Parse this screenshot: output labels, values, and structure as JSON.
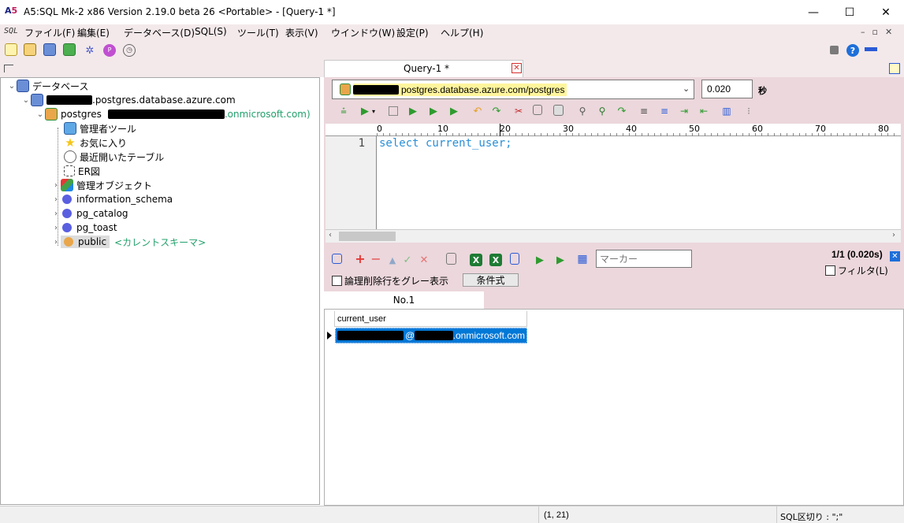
{
  "window": {
    "title": "A5:SQL Mk-2 x86 Version 2.19.0 beta 26 <Portable> - [Query-1 *]",
    "minimize": "—",
    "maximize": "☐",
    "close": "✕"
  },
  "menu": {
    "sql_logo": "SQL",
    "items": [
      "ファイル(F)",
      "編集(E)",
      "データベース(D)",
      "SQL(S)",
      "ツール(T)",
      "表示(V)",
      "ウインドウ(W)",
      "設定(P)",
      "ヘルプ(H)"
    ]
  },
  "tree": {
    "root": "データベース",
    "server_suffix": ".postgres.database.azure.com",
    "db_name": "postgres",
    "db_user_suffix": ".onmicrosoft.com)",
    "items": [
      "管理者ツール",
      "お気に入り",
      "最近開いたテーブル",
      "ER図",
      "管理オブジェクト",
      "information_schema",
      "pg_catalog",
      "pg_toast",
      "public"
    ],
    "current_schema": "<カレントスキーマ>"
  },
  "query_tab": {
    "label": "Query-1 *"
  },
  "connection": {
    "suffix": "postgres.database.azure.com/postgres"
  },
  "exec_time": {
    "value": "0.020",
    "unit": "秒"
  },
  "ruler": {
    "ticks": [
      "0",
      "10",
      "20",
      "30",
      "40",
      "50",
      "60",
      "70",
      "80"
    ]
  },
  "editor": {
    "line_number": "1",
    "code": "select current_user;"
  },
  "result_toolbar": {
    "marker_placeholder": "マーカー",
    "row_info": "1/1 (0.020s)",
    "filter_label": "フィルタ(L)",
    "gray_deleted_label": "論理削除行をグレー表示",
    "condition_button": "条件式"
  },
  "result_tab": {
    "label": "No.1"
  },
  "grid": {
    "columns": [
      "current_user"
    ],
    "rows": [
      [
        "@.onmicrosoft.com"
      ]
    ],
    "cell_visible_suffix": ".onmicrosoft.com"
  },
  "status": {
    "position": "(1, 21)",
    "sql_delimiter": "SQL区切り : \";\""
  },
  "colors": {
    "pink": "#ebd7dc",
    "accent": "#0078d7",
    "sql_text": "#2a8fd6",
    "schema_green": "#22a06b"
  }
}
